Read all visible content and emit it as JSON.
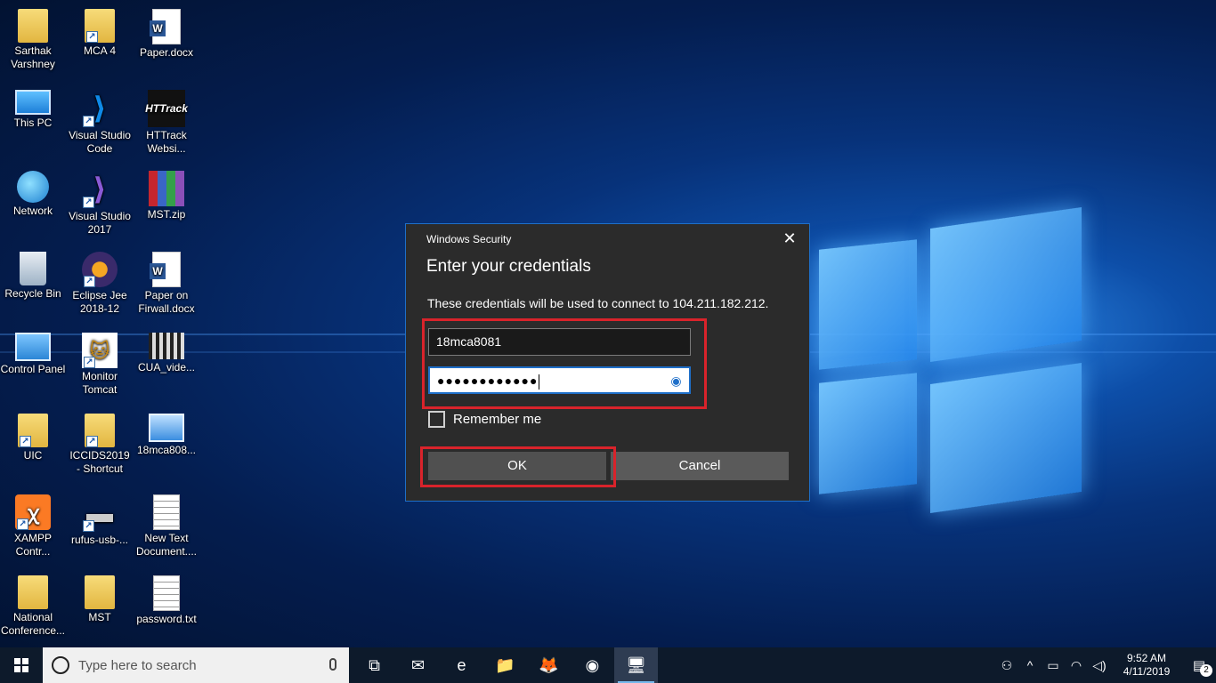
{
  "desktop": {
    "icons": [
      {
        "label": "Sarthak Varshney",
        "icon": "user-folder-icon"
      },
      {
        "label": "MCA 4",
        "icon": "folder-shortcut-icon"
      },
      {
        "label": "Paper.docx",
        "icon": "word-doc-icon"
      },
      {
        "label": "This PC",
        "icon": "computer-icon"
      },
      {
        "label": "Visual Studio Code",
        "icon": "vscode-icon"
      },
      {
        "label": "HTTrack Websi...",
        "icon": "httrack-icon"
      },
      {
        "label": "Network",
        "icon": "network-icon"
      },
      {
        "label": "Visual Studio 2017",
        "icon": "visual-studio-icon"
      },
      {
        "label": "MST.zip",
        "icon": "winrar-archive-icon"
      },
      {
        "label": "Recycle Bin",
        "icon": "recycle-bin-icon"
      },
      {
        "label": "Eclipse Jee 2018-12",
        "icon": "eclipse-icon"
      },
      {
        "label": "Paper on Firwall.docx",
        "icon": "word-doc-icon"
      },
      {
        "label": "Control Panel",
        "icon": "control-panel-icon"
      },
      {
        "label": "Monitor Tomcat",
        "icon": "tomcat-icon"
      },
      {
        "label": "CUA_vide...",
        "icon": "video-file-icon"
      },
      {
        "label": "UIC",
        "icon": "folder-shortcut-icon"
      },
      {
        "label": "ICCIDS2019 - Shortcut",
        "icon": "chrome-folder-shortcut-icon"
      },
      {
        "label": "18mca808...",
        "icon": "remote-desktop-file-icon"
      },
      {
        "label": "XAMPP Contr...",
        "icon": "xampp-icon"
      },
      {
        "label": "rufus-usb-...",
        "icon": "usb-drive-icon"
      },
      {
        "label": "New Text Document....",
        "icon": "text-file-icon"
      },
      {
        "label": "National Conference...",
        "icon": "folder-icon"
      },
      {
        "label": "MST",
        "icon": "folder-icon"
      },
      {
        "label": "password.txt",
        "icon": "text-file-icon"
      }
    ]
  },
  "dialog": {
    "caption": "Windows Security",
    "title": "Enter your credentials",
    "message": "These credentials will be used to connect to 104.211.182.212.",
    "username_value": "18mca8081",
    "password_masked": "●●●●●●●●●●●●",
    "remember_label": "Remember me",
    "remember_checked": false,
    "ok_label": "OK",
    "cancel_label": "Cancel",
    "close_glyph": "✕",
    "accent_color": "#1e6fc9",
    "highlight_color": "#d9232b"
  },
  "taskbar": {
    "search_placeholder": "Type here to search",
    "apps": [
      {
        "name": "task-view-icon",
        "glyph": "⧉"
      },
      {
        "name": "mail-icon",
        "glyph": "✉"
      },
      {
        "name": "edge-icon",
        "glyph": "e"
      },
      {
        "name": "file-explorer-icon",
        "glyph": "📁"
      },
      {
        "name": "firefox-icon",
        "glyph": "🦊"
      },
      {
        "name": "chrome-icon",
        "glyph": "◉"
      },
      {
        "name": "remote-desktop-icon",
        "glyph": "🖥"
      }
    ],
    "time": "9:52 AM",
    "date": "4/11/2019",
    "notification_count": "2"
  }
}
